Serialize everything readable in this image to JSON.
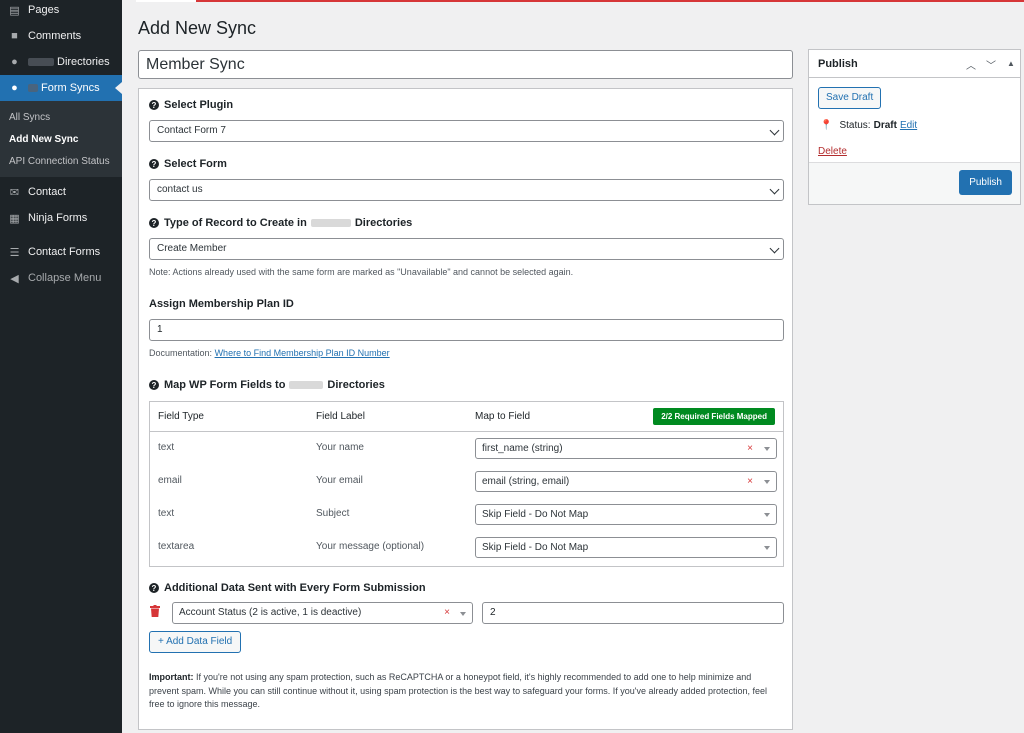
{
  "sidebar": {
    "items": [
      {
        "label": "Pages",
        "icon": "pages-icon"
      },
      {
        "label": "Comments",
        "icon": "comments-icon"
      },
      {
        "label": "Directories",
        "icon": "pin-icon"
      },
      {
        "label": "Form Syncs",
        "icon": "lightbulb-icon"
      },
      {
        "label": "Contact",
        "icon": "mail-icon"
      },
      {
        "label": "Ninja Forms",
        "icon": "form-icon"
      },
      {
        "label": "Contact Forms",
        "icon": "list-icon"
      },
      {
        "label": "Collapse Menu",
        "icon": "collapse-icon"
      }
    ],
    "submenu": [
      "All Syncs",
      "Add New Sync",
      "API Connection Status"
    ]
  },
  "page": {
    "title": "Add New Sync",
    "post_title": "Member Sync"
  },
  "form": {
    "plugin_label": "Select Plugin",
    "plugin_value": "Contact Form 7",
    "form_label": "Select Form",
    "form_value": "contact us",
    "record_label_pre": "Type of Record to Create in",
    "record_label_post": "Directories",
    "record_value": "Create Member",
    "record_note": "Note: Actions already used with the same form are marked as \"Unavailable\" and cannot be selected again.",
    "plan_label": "Assign Membership Plan ID",
    "plan_value": "1",
    "doc_prefix": "Documentation:",
    "doc_link": "Where to Find Membership Plan ID Number"
  },
  "mapping": {
    "label_pre": "Map WP Form Fields to",
    "label_post": "Directories",
    "headers": {
      "type": "Field Type",
      "label": "Field Label",
      "map": "Map to Field"
    },
    "badge": "2/2 Required Fields Mapped",
    "rows": [
      {
        "type": "text",
        "label": "Your name",
        "map": "first_name (string)",
        "clearable": "×"
      },
      {
        "type": "email",
        "label": "Your email",
        "map": "email (string, email)",
        "clearable": "×"
      },
      {
        "type": "text",
        "label": "Subject",
        "map": "Skip Field - Do Not Map",
        "clearable": ""
      },
      {
        "type": "textarea",
        "label": "Your message (optional)",
        "map": "Skip Field - Do Not Map",
        "clearable": ""
      }
    ]
  },
  "additional": {
    "label": "Additional Data Sent with Every Form Submission",
    "field": "Account Status (2 is active, 1 is deactive)",
    "clear": "×",
    "value": "2",
    "add_button": "+ Add Data Field"
  },
  "important": {
    "title": "Important:",
    "text": "If you're not using any spam protection, such as ReCAPTCHA or a honeypot field, it's highly recommended to add one to help minimize and prevent spam. While you can still continue without it, using spam protection is the best way to safeguard your forms. If you've already added protection, feel free to ignore this message."
  },
  "publish": {
    "title": "Publish",
    "save_draft": "Save Draft",
    "status_label": "Status:",
    "status_value": "Draft",
    "edit": "Edit",
    "delete": "Delete",
    "publish": "Publish"
  },
  "colors": {
    "accent": "#2271b1",
    "sidebar": "#1d2327",
    "success": "#008a20",
    "danger": "#d63638"
  }
}
